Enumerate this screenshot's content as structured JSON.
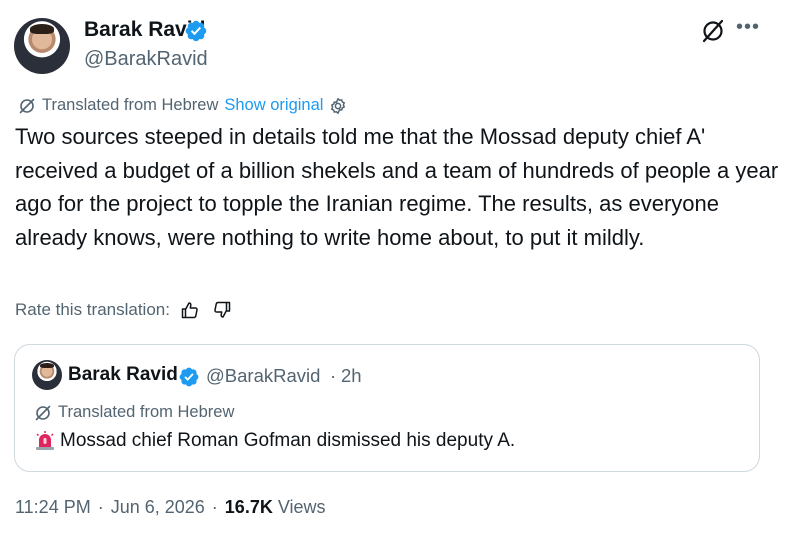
{
  "author": {
    "name": "Barak Ravid",
    "handle": "@BarakRavid"
  },
  "translation": {
    "label": "Translated from Hebrew",
    "show_original": "Show original"
  },
  "tweet": {
    "text": "Two sources steeped in details told me that the Mossad deputy chief A' received a budget of a billion shekels and a team of hundreds of people a year ago for the project to topple the Iranian regime. The results, as everyone already knows, were nothing to write home about, to put it mildly."
  },
  "rate": {
    "label": "Rate this translation:"
  },
  "quote": {
    "name": "Barak Ravid",
    "handle": "@BarakRavid",
    "separator": "·",
    "time": "2h",
    "translated_label": "Translated from Hebrew",
    "text": "Mossad chief Roman Gofman dismissed his deputy A."
  },
  "footer": {
    "time": "11:24 PM",
    "date": "Jun 6, 2026",
    "separator": "·",
    "views_count": "16.7K",
    "views_label": "Views"
  },
  "icons": {
    "verified": "verified-badge-icon",
    "grok": "grok-icon",
    "more": "more-icon",
    "translate": "translate-icon",
    "settings": "settings-icon",
    "thumbs_up": "thumbs-up-icon",
    "thumbs_down": "thumbs-down-icon",
    "siren": "siren-icon"
  },
  "colors": {
    "accent": "#1d9bf0",
    "secondary_text": "#536471",
    "border": "#cfd9de",
    "siren": "#e0245e"
  }
}
